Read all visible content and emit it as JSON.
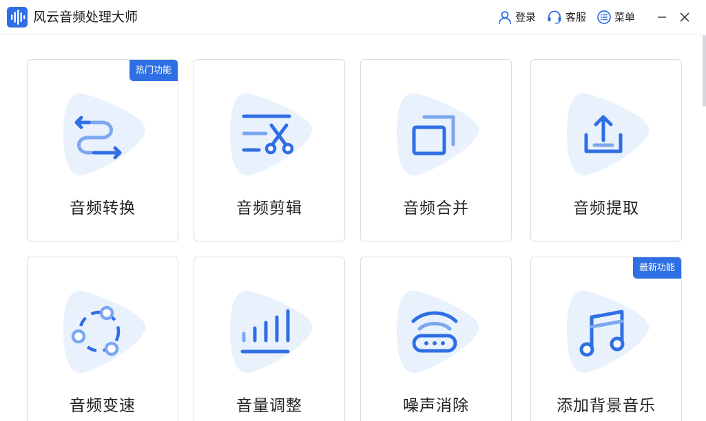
{
  "window": {
    "title": "风云音频处理大师",
    "login_label": "登录",
    "support_label": "客服",
    "menu_label": "菜单"
  },
  "colors": {
    "accent": "#2f6fe4",
    "icon_bg": "#e9f1fd",
    "border": "#d9dde4"
  },
  "cards": [
    {
      "label": "音频转换",
      "icon": "convert-icon",
      "badge": "热门功能"
    },
    {
      "label": "音频剪辑",
      "icon": "scissors-edit-icon",
      "badge": ""
    },
    {
      "label": "音频合并",
      "icon": "merge-windows-icon",
      "badge": ""
    },
    {
      "label": "音频提取",
      "icon": "upload-extract-icon",
      "badge": ""
    },
    {
      "label": "音频变速",
      "icon": "speed-circle-icon",
      "badge": ""
    },
    {
      "label": "音量调整",
      "icon": "volume-bars-icon",
      "badge": ""
    },
    {
      "label": "噪声消除",
      "icon": "noise-router-icon",
      "badge": ""
    },
    {
      "label": "添加背景音乐",
      "icon": "music-note-icon",
      "badge": "最新功能"
    }
  ]
}
